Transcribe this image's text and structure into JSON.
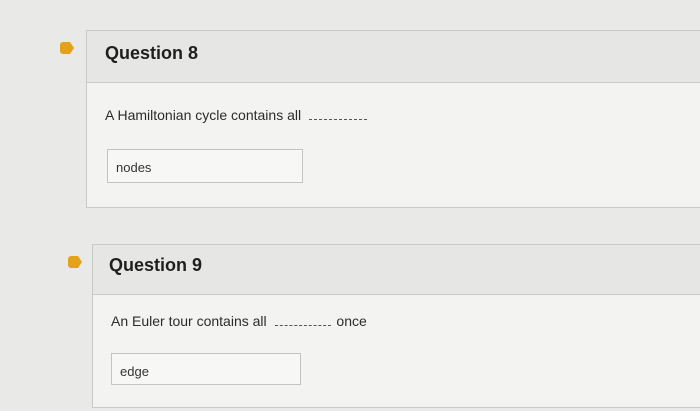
{
  "questions": [
    {
      "title": "Question 8",
      "prompt_before": "A Hamiltonian cycle contains all",
      "prompt_after": "",
      "answer": "nodes"
    },
    {
      "title": "Question 9",
      "prompt_before": "An Euler tour contains all",
      "prompt_after": "once",
      "answer": "edge"
    }
  ],
  "colors": {
    "flag": "#e3a21a",
    "card_background": "#f3f3f1",
    "header_background": "#e6e6e4",
    "page_background": "#e9e9e7"
  }
}
